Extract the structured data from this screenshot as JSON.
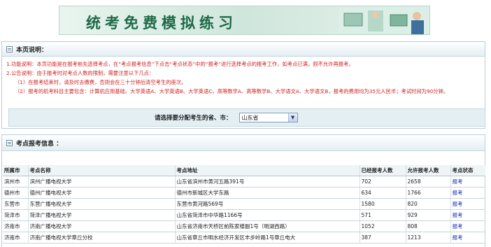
{
  "banner": {
    "title": "统考免费模拟练习"
  },
  "instructions": {
    "title": "本页说明：",
    "lines": [
      "1.功能说明：本页功能是在报考前先选择考点，在“考点报考信息”下点击“考点状态”中的“报考”进行选择考点的报考工作，如考点已满，则不允许再报考。",
      "2.公告说明：由于报考时对考点人数的限制，需要注意以下几点：",
      "（1）在报考结束时，请及时去缴费，否则会在三十分钟后清空考生的座次。",
      "（2）报考的机考科目主要包含：计算机应用基础、大学英语A、大学英语B、大学英语C，高等数学A、高等数学B、大学语文A、大学语文B，报考的费用均为35元人民币；考试时间为90分钟。"
    ]
  },
  "selector": {
    "label": "请选择要分配考生的省、市：",
    "selected": "山东省"
  },
  "sites": {
    "title": "考点报考信息 ："
  },
  "table": {
    "headers": [
      "所属市",
      "考点名称",
      "考点地址",
      "已经报考人数",
      "允许报考人数",
      "考点状态"
    ],
    "rows": [
      [
        "滨州市",
        "滨州广播电视大学",
        "山东省滨州市黄河五路391号",
        "702",
        "2658",
        "报考"
      ],
      [
        "德州市",
        "德州广播电视大学",
        "德州市新城区大学东路",
        "634",
        "1766",
        "报考"
      ],
      [
        "东营市",
        "东营广播电视大学",
        "东营市黄河路569号",
        "1580",
        "820",
        "报考"
      ],
      [
        "菏泽市",
        "菏泽广播电视大学",
        "山东省菏泽市中华路1166号",
        "571",
        "929",
        "报考"
      ],
      [
        "济南市",
        "济南广播电视大学",
        "山东省济南市天桥区前陈家楼副1号（明湖西路）",
        "1052",
        "808",
        "报考"
      ],
      [
        "济南市",
        "济南广播电视大学章丘分校",
        "山东省章丘市明水经济开发区丰步岭路1号章丘电大",
        "387",
        "1213",
        "报考"
      ]
    ]
  }
}
